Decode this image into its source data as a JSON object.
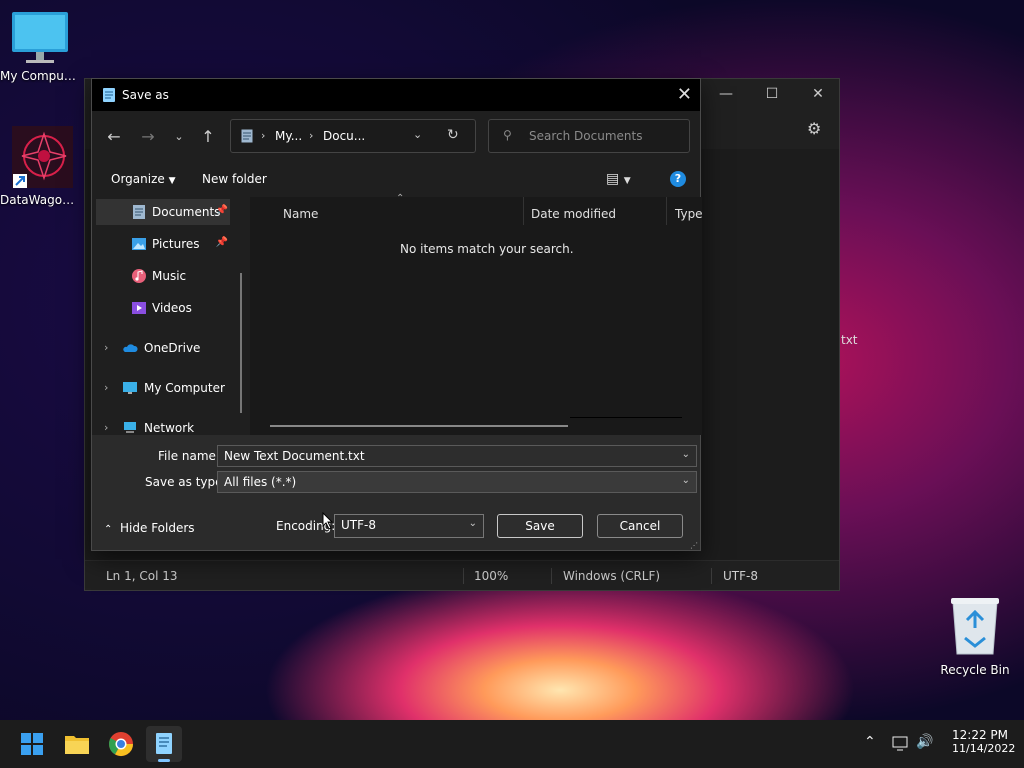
{
  "desktop": {
    "icons": [
      {
        "label": "My Computer"
      },
      {
        "label": "DataWagon..."
      },
      {
        "label": "Recycle Bin"
      }
    ],
    "partial_text": "txt"
  },
  "notepad": {
    "status": {
      "position": "Ln 1, Col 13",
      "zoom": "100%",
      "line_ending": "Windows (CRLF)",
      "encoding": "UTF-8"
    }
  },
  "dialog": {
    "title": "Save as",
    "breadcrumb": [
      "My...",
      "Docu..."
    ],
    "search_placeholder": "Search Documents",
    "toolbar": {
      "organize": "Organize",
      "new_folder": "New folder"
    },
    "nav_items": [
      {
        "label": "Documents",
        "pinned": true
      },
      {
        "label": "Pictures",
        "pinned": true
      },
      {
        "label": "Music"
      },
      {
        "label": "Videos"
      },
      {
        "label": "OneDrive"
      },
      {
        "label": "My Computer"
      },
      {
        "label": "Network"
      }
    ],
    "columns": {
      "name": "Name",
      "date": "Date modified",
      "type": "Type"
    },
    "empty_message": "No items match your search.",
    "file_name_label": "File name:",
    "file_name_value": "New Text Document.txt",
    "save_type_label": "Save as type:",
    "save_type_value": "All files  (*.*)",
    "hide_folders": "Hide Folders",
    "encoding_label": "Encoding:",
    "encoding_value": "UTF-8",
    "save_button": "Save",
    "cancel_button": "Cancel"
  },
  "taskbar": {
    "time": "12:22 PM",
    "date": "11/14/2022"
  },
  "colors": {
    "accent": "#0078d4",
    "dialog_bg": "#1f1f1f",
    "taskbar_bg": "#1c1c1c"
  }
}
